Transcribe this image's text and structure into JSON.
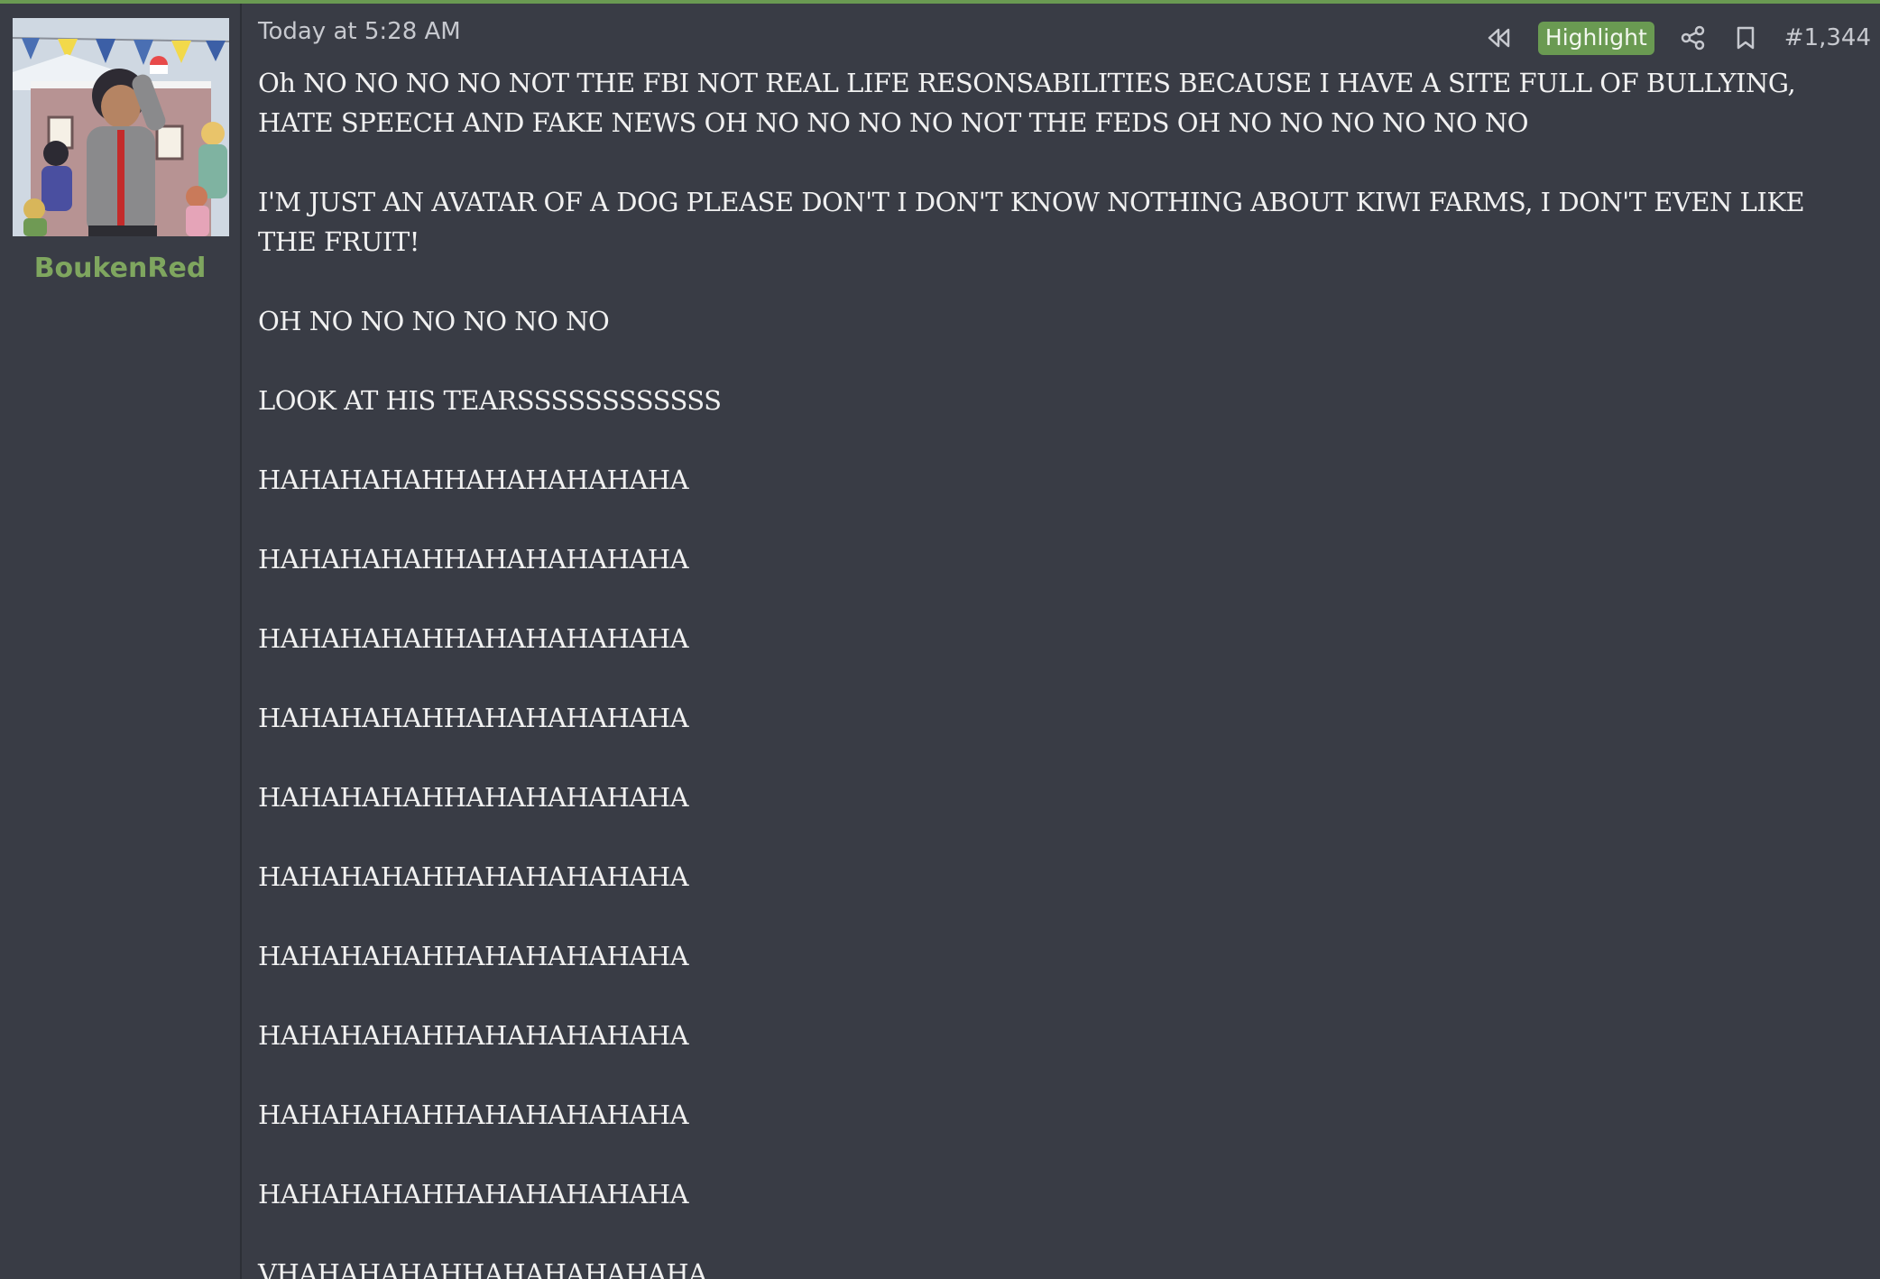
{
  "post": {
    "timestamp": "Today at 5:28 AM",
    "highlight_label": "Highlight",
    "post_number": "#1,344",
    "paragraphs": [
      "Oh NO NO NO NO NOT THE FBI NOT REAL LIFE RESONSABILITIES BECAUSE I HAVE A SITE FULL OF BULLYING, HATE SPEECH AND FAKE NEWS OH NO NO NO NO NOT THE FEDS OH NO NO NO NO NO NO",
      "I'M JUST AN AVATAR OF A DOG PLEASE DON'T I DON'T KNOW NOTHING ABOUT KIWI FARMS, I DON'T EVEN LIKE THE FRUIT!",
      "OH NO NO NO NO NO NO",
      "LOOK AT HIS TEARSSSSSSSSSSSS",
      "HAHAHAHAHHAHAHAHAHAHA",
      "HAHAHAHAHHAHAHAHAHAHA",
      "HAHAHAHAHHAHAHAHAHAHA",
      "HAHAHAHAHHAHAHAHAHAHA",
      "HAHAHAHAHHAHAHAHAHAHA",
      "HAHAHAHAHHAHAHAHAHAHA",
      "HAHAHAHAHHAHAHAHAHAHA",
      "HAHAHAHAHHAHAHAHAHAHA",
      "HAHAHAHAHHAHAHAHAHAHA",
      "HAHAHAHAHHAHAHAHAHAHA",
      "VHAHAHAHAHHAHAHAHAHAHA"
    ]
  },
  "author": {
    "username": "BoukenRed"
  },
  "icons": {
    "rewind": "rewind-icon",
    "share": "share-icon",
    "bookmark": "bookmark-icon"
  },
  "colors": {
    "background": "#393c45",
    "accent": "#6a9a52",
    "username": "#7fa65f",
    "text": "#f1f1f1",
    "muted": "#c7c9cf"
  }
}
